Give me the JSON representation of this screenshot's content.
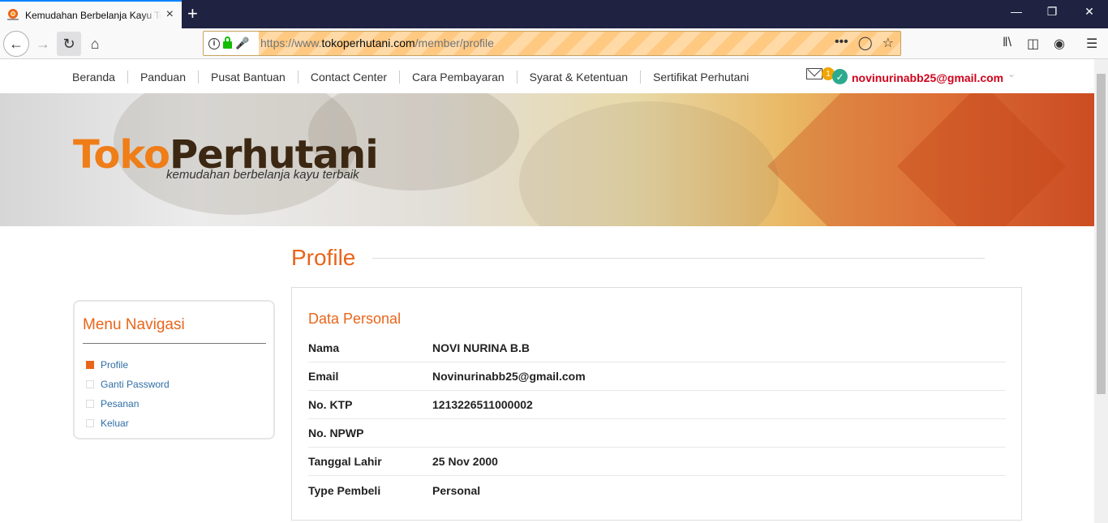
{
  "browser": {
    "tab_title": "Kemudahan Berbelanja Kayu Terbaik",
    "tab_close": "×",
    "new_tab": "+",
    "url_scheme": "https://www.",
    "url_domain": "tokoperhutani.com",
    "url_path": "/member/profile",
    "window_controls": [
      "—",
      "❐",
      "✕"
    ]
  },
  "site_nav": {
    "items": [
      "Beranda",
      "Panduan",
      "Pusat Bantuan",
      "Contact Center",
      "Cara Pembayaran",
      "Syarat & Ketentuan",
      "Sertifikat Perhutani"
    ],
    "mail_badge": "1",
    "user_email": "novinurinabb25@gmail.com"
  },
  "banner": {
    "logo_part1": "Toko",
    "logo_part2": "Perhutani",
    "tagline": "kemudahan berbelanja kayu terbaik"
  },
  "page": {
    "title": "Profile"
  },
  "sidebar": {
    "heading": "Menu Navigasi",
    "items": [
      {
        "label": "Profile",
        "active": true
      },
      {
        "label": "Ganti Password",
        "active": false
      },
      {
        "label": "Pesanan",
        "active": false
      },
      {
        "label": "Keluar",
        "active": false
      }
    ]
  },
  "personal": {
    "heading": "Data Personal",
    "rows": [
      {
        "label": "Nama",
        "value": "NOVI NURINA B.B"
      },
      {
        "label": "Email",
        "value": "Novinurinabb25@gmail.com"
      },
      {
        "label": "No. KTP",
        "value": "1213226511000002"
      },
      {
        "label": "No. NPWP",
        "value": ""
      },
      {
        "label": "Tanggal Lahir",
        "value": "25 Nov 2000"
      },
      {
        "label": "Type Pembeli",
        "value": "Personal"
      }
    ]
  },
  "colors": {
    "accent": "#e8651a",
    "link": "#2f6ea5",
    "email_red": "#d0021b"
  }
}
